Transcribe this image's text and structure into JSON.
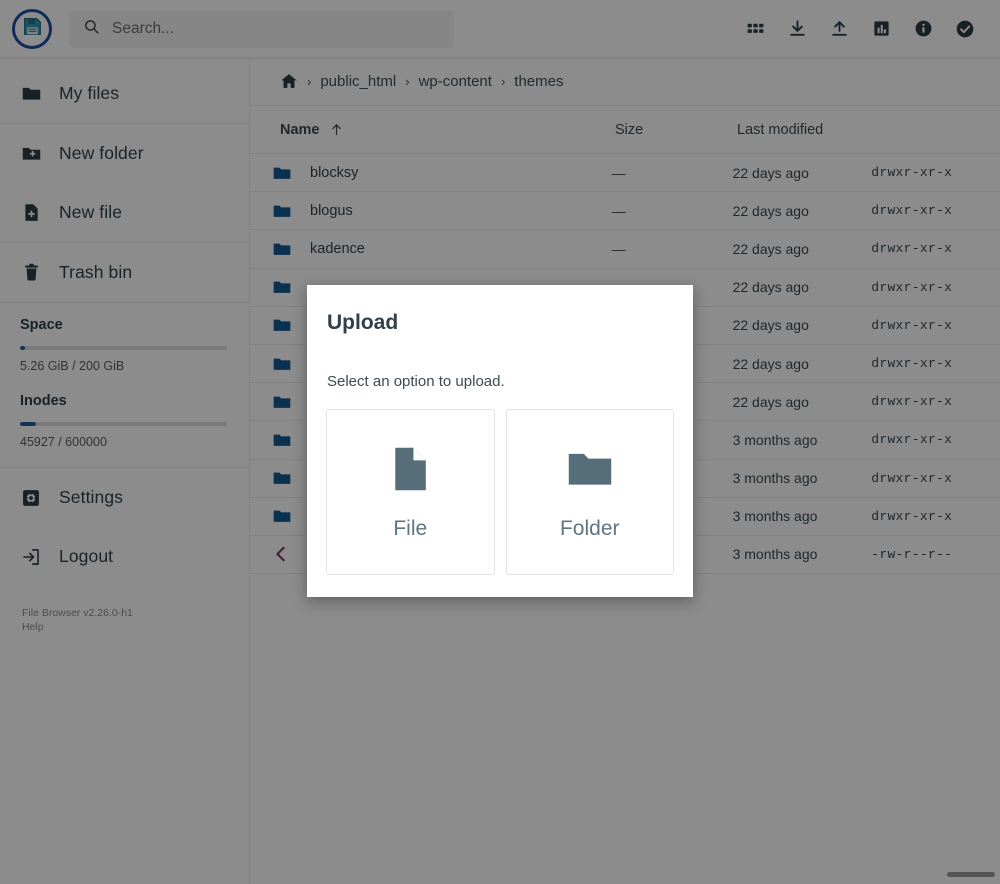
{
  "header": {
    "logo_icon": "floppy-disk-icon",
    "search": {
      "icon": "search-icon",
      "placeholder": "Search...",
      "value": ""
    },
    "actions": [
      {
        "name": "switch-view-button",
        "icon": "grid-icon",
        "label": "Switch view"
      },
      {
        "name": "download-button",
        "icon": "download-icon",
        "label": "Download"
      },
      {
        "name": "upload-button",
        "icon": "upload-icon",
        "label": "Upload"
      },
      {
        "name": "usage-button",
        "icon": "bar-chart-icon",
        "label": "Usage"
      },
      {
        "name": "info-button",
        "icon": "info-circle-icon",
        "label": "Info"
      },
      {
        "name": "select-multiple-button",
        "icon": "check-circle-icon",
        "label": "Select multiple"
      }
    ]
  },
  "sidebar": {
    "items": [
      {
        "label": "My files",
        "icon": "folder-icon"
      },
      {
        "label": "New folder",
        "icon": "folder-plus-icon"
      },
      {
        "label": "New file",
        "icon": "file-plus-icon"
      },
      {
        "label": "Trash bin",
        "icon": "trash-icon"
      },
      {
        "label": "Settings",
        "icon": "gear-icon"
      },
      {
        "label": "Logout",
        "icon": "logout-icon"
      }
    ],
    "space": {
      "title": "Space",
      "text": "5.26 GiB / 200 GiB",
      "percent": 2.63
    },
    "inodes": {
      "title": "Inodes",
      "text": "45927 / 600000",
      "percent": 7.65
    },
    "footer": {
      "version": "File Browser v2.26.0-h1",
      "help": "Help"
    }
  },
  "breadcrumb": {
    "home_icon": "home-icon",
    "separator": "›",
    "items": [
      "public_html",
      "wp-content",
      "themes"
    ]
  },
  "table": {
    "columns": {
      "name": "Name",
      "sort_icon": "arrow-up-icon",
      "size": "Size",
      "modified": "Last modified",
      "permissions": ""
    },
    "rows": [
      {
        "name": "blocksy",
        "icon": "folder-icon",
        "size": "—",
        "modified": "22 days ago",
        "permissions": "drwxr-xr-x"
      },
      {
        "name": "blogus",
        "icon": "folder-icon",
        "size": "—",
        "modified": "22 days ago",
        "permissions": "drwxr-xr-x"
      },
      {
        "name": "kadence",
        "icon": "folder-icon",
        "size": "—",
        "modified": "22 days ago",
        "permissions": "drwxr-xr-x"
      },
      {
        "name": "",
        "icon": "folder-icon",
        "size": "",
        "modified": "22 days ago",
        "permissions": "drwxr-xr-x"
      },
      {
        "name": "",
        "icon": "folder-icon",
        "size": "",
        "modified": "22 days ago",
        "permissions": "drwxr-xr-x"
      },
      {
        "name": "",
        "icon": "folder-icon",
        "size": "",
        "modified": "22 days ago",
        "permissions": "drwxr-xr-x"
      },
      {
        "name": "",
        "icon": "folder-icon",
        "size": "",
        "modified": "22 days ago",
        "permissions": "drwxr-xr-x"
      },
      {
        "name": "",
        "icon": "folder-icon",
        "size": "",
        "modified": "3 months ago",
        "permissions": "drwxr-xr-x"
      },
      {
        "name": "",
        "icon": "folder-icon",
        "size": "",
        "modified": "3 months ago",
        "permissions": "drwxr-xr-x"
      },
      {
        "name": "",
        "icon": "folder-icon",
        "size": "",
        "modified": "3 months ago",
        "permissions": "drwxr-xr-x"
      },
      {
        "name": "",
        "icon": "back-chevron-icon",
        "size": "",
        "modified": "3 months ago",
        "permissions": "-rw-r--r--"
      }
    ]
  },
  "modal": {
    "title": "Upload",
    "description": "Select an option to upload.",
    "options": [
      {
        "label": "File",
        "icon": "file-icon"
      },
      {
        "label": "Folder",
        "icon": "folder-icon"
      }
    ]
  },
  "colors": {
    "accent_blue": "#2060a8",
    "folder_blue": "#155a94",
    "dark_slate": "#2c3e46",
    "modal_icon": "#566e79",
    "overlay": "rgba(0,0,0,0.45)"
  }
}
